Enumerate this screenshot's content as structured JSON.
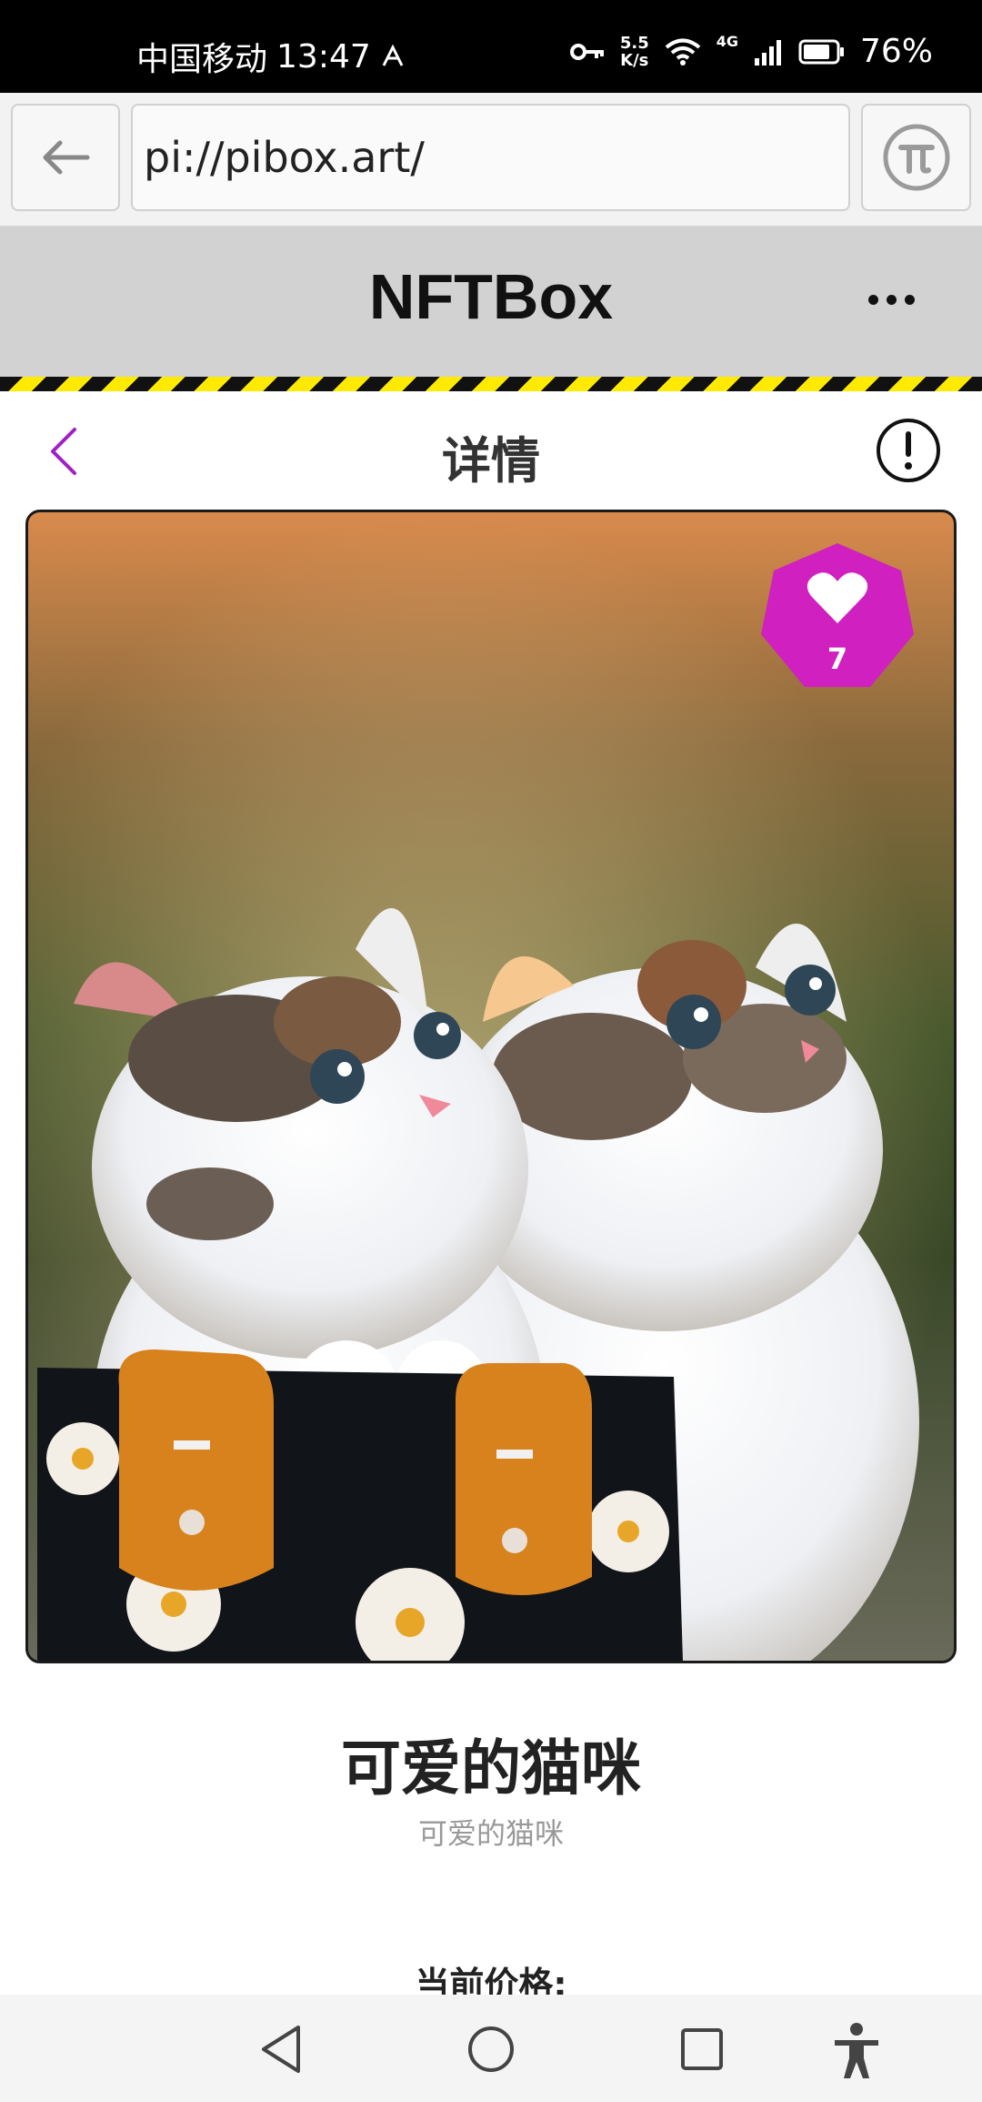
{
  "status_bar": {
    "carrier": "中国移动",
    "time": "13:47",
    "net_speed_value": "5.5",
    "net_speed_unit": "K/s",
    "signal_type": "4G",
    "battery": "76%"
  },
  "browser": {
    "url": "pi://pibox.art/"
  },
  "app_header": {
    "title": "NFTBox"
  },
  "detail_header": {
    "title": "详情"
  },
  "nft": {
    "likes": "7",
    "name": "可爱的猫咪",
    "description": "可爱的猫咪",
    "price_label": "当前价格:"
  },
  "colors": {
    "accent_purple": "#a020c8",
    "like_badge": "#d020c0",
    "stripe_yellow": "#ffea00"
  },
  "icons": {
    "browser_back": "arrow-left-icon",
    "pi_logo": "pi-logo-icon",
    "more": "more-horizontal-icon",
    "detail_back": "chevron-left-icon",
    "info": "info-icon",
    "like": "heart-icon",
    "nav_back": "nav-back-triangle-icon",
    "nav_home": "nav-home-circle-icon",
    "nav_recent": "nav-recent-square-icon",
    "accessibility": "accessibility-icon"
  }
}
